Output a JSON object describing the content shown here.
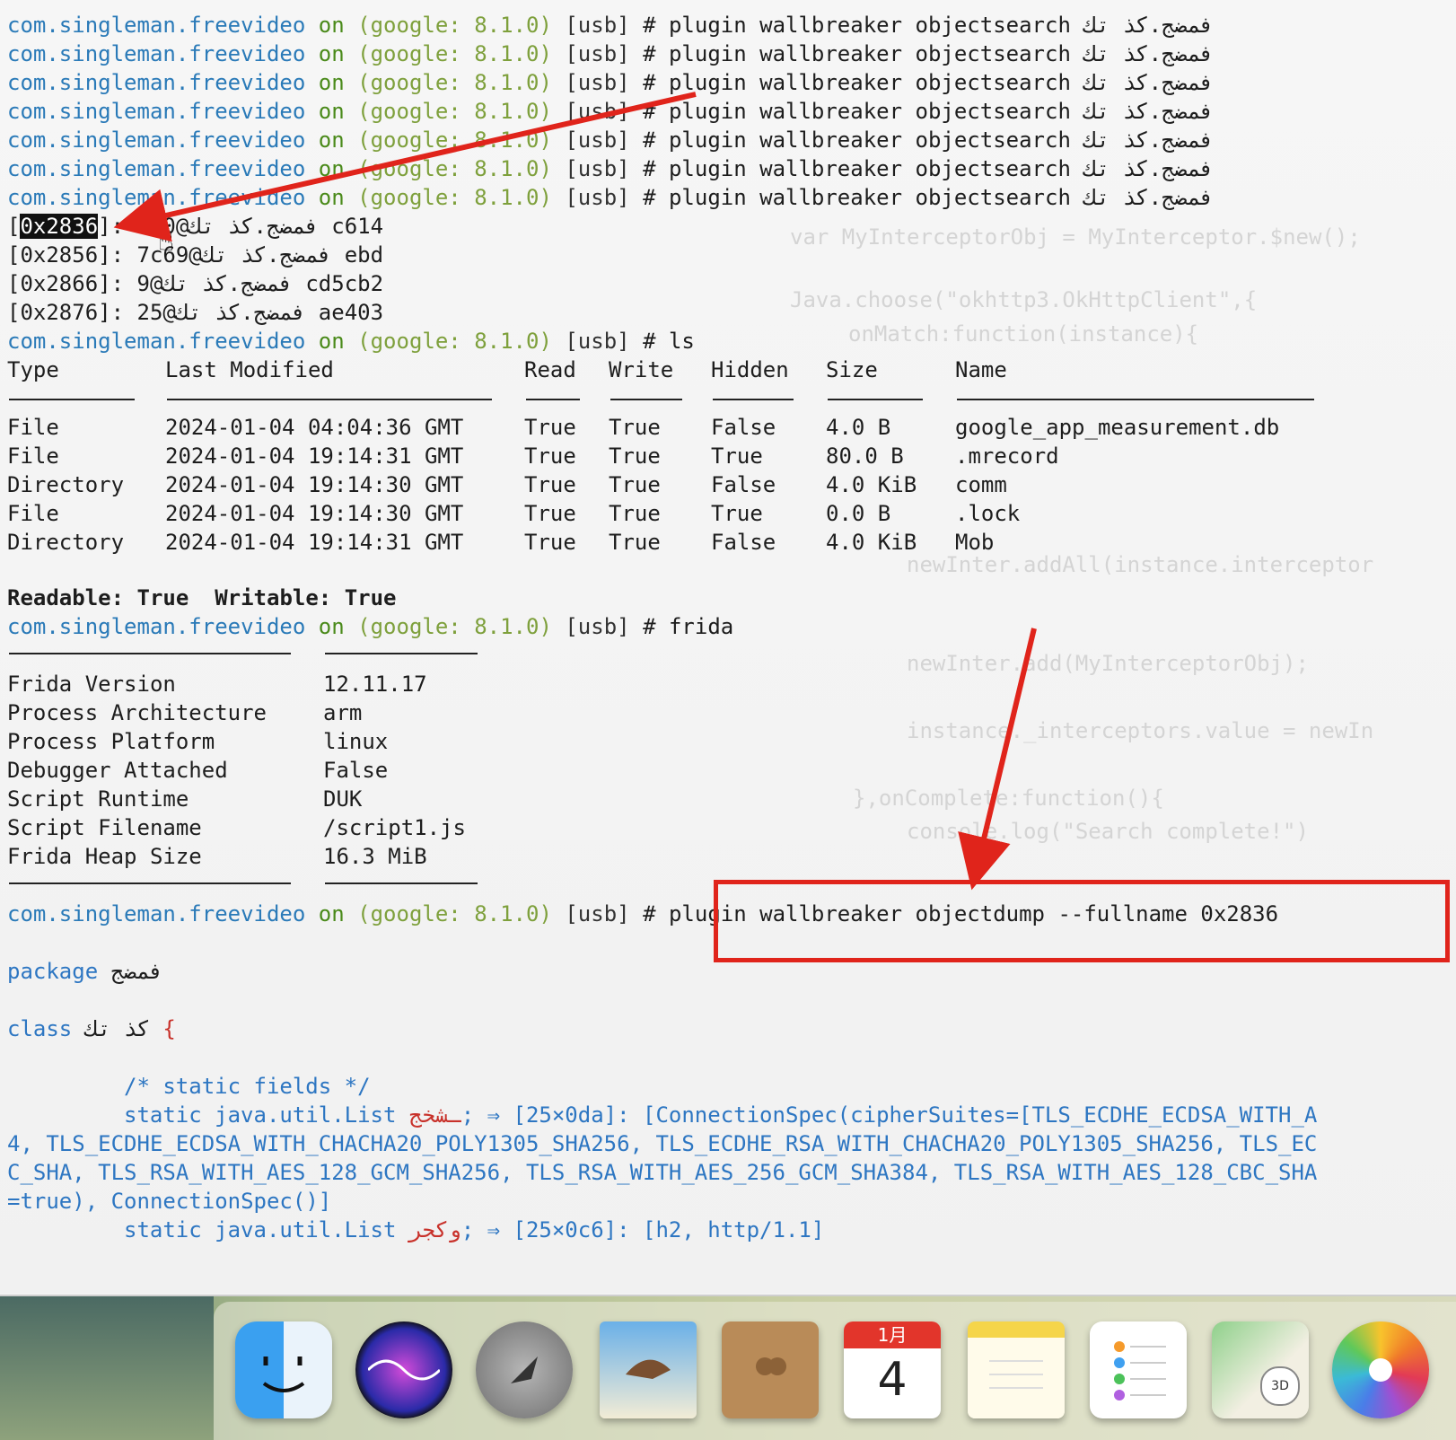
{
  "terminal": {
    "prompt": {
      "app": "com.singleman.freevideo",
      "on": "on",
      "device": "(google: 8.1.0)",
      "conn": "[usb]",
      "hash": "#"
    },
    "search_lines": [
      {
        "cmd": "plugin wallbreaker objectsearch فمضج.كذ تك"
      },
      {
        "cmd": "plugin wallbreaker objectsearch فمضج.كذ تك"
      },
      {
        "cmd": "plugin wallbreaker objectsearch فمضج.كذ تك"
      },
      {
        "cmd": "plugin wallbreaker objectsearch فمضج.كذ تك"
      },
      {
        "cmd": "plugin wallbreaker objectsearch فمضج.كذ تك"
      },
      {
        "cmd": "plugin wallbreaker objectsearch فمضج.كذ تك"
      },
      {
        "cmd": "plugin wallbreaker objectsearch فمضج.كذ تك"
      }
    ],
    "results": [
      {
        "handle": "0x2836",
        "value": ": 550@فمضج.كذ تك c614"
      },
      {
        "handle": "[0x2856]",
        "value": ": 7c69@فمضج.كذ تك ebd"
      },
      {
        "handle": "[0x2866]",
        "value": ": 9@فمضج.كذ تك cd5cb2"
      },
      {
        "handle": "[0x2876]",
        "value": ": 25@فمضج.كذ تك ae403"
      }
    ],
    "ls_cmd": "ls",
    "ls_table": {
      "headers": [
        "Type",
        "Last Modified",
        "Read",
        "Write",
        "Hidden",
        "Size",
        "Name"
      ],
      "rows": [
        [
          "File",
          "2024-01-04 04:04:36 GMT",
          "True",
          "True",
          "False",
          "4.0 B",
          "google_app_measurement.db"
        ],
        [
          "File",
          "2024-01-04 19:14:31 GMT",
          "True",
          "True",
          "True",
          "80.0 B",
          ".mrecord"
        ],
        [
          "Directory",
          "2024-01-04 19:14:30 GMT",
          "True",
          "True",
          "False",
          "4.0 KiB",
          "comm"
        ],
        [
          "File",
          "2024-01-04 19:14:30 GMT",
          "True",
          "True",
          "True",
          "0.0 B",
          ".lock"
        ],
        [
          "Directory",
          "2024-01-04 19:14:31 GMT",
          "True",
          "True",
          "False",
          "4.0 KiB",
          "Mob"
        ]
      ]
    },
    "readable_label": "Readable:",
    "readable_value": "True",
    "writable_label": "Writable:",
    "writable_value": "True",
    "frida_cmd": "frida",
    "frida_info": [
      [
        "Frida Version",
        "12.11.17"
      ],
      [
        "Process Architecture",
        "arm"
      ],
      [
        "Process Platform",
        "linux"
      ],
      [
        "Debugger Attached",
        "False"
      ],
      [
        "Script Runtime",
        "DUK"
      ],
      [
        "Script Filename",
        "/script1.js"
      ],
      [
        "Frida Heap Size",
        "16.3 MiB"
      ]
    ],
    "dump_cmd": "plugin wallbreaker objectdump --fullname 0x2836",
    "package_kw": "package",
    "package_name": "فمضج",
    "class_kw": "class",
    "class_name": "كذ تك",
    "brace": "{",
    "static_comment": "/* static fields */",
    "field1_decl": "static java.util.List",
    "field1_name": "ـشخج",
    "field1_rest": "; ⇒ [0×25da]: [ConnectionSpec(cipherSuites=[TLS_ECDHE_ECDSA_WITH_A",
    "wrap1": "4, TLS_ECDHE_ECDSA_WITH_CHACHA20_POLY1305_SHA256, TLS_ECDHE_RSA_WITH_CHACHA20_POLY1305_SHA256, TLS_EC",
    "wrap2": "C_SHA, TLS_RSA_WITH_AES_128_GCM_SHA256, TLS_RSA_WITH_AES_256_GCM_SHA384, TLS_RSA_WITH_AES_128_CBC_SHA",
    "wrap3": "=true), ConnectionSpec()]",
    "field2_decl": "static java.util.List",
    "field2_name": "وكجر",
    "field2_rest": "; ⇒ [0×25c6]: [h2, http/1.1]"
  },
  "dock": {
    "items": [
      {
        "name": "Finder",
        "icon": "finder-icon"
      },
      {
        "name": "Siri",
        "icon": "siri-icon"
      },
      {
        "name": "Launchpad",
        "icon": "launchpad-icon"
      },
      {
        "name": "Mail",
        "icon": "mail-icon"
      },
      {
        "name": "Contacts",
        "icon": "contacts-icon"
      },
      {
        "name": "Calendar",
        "icon": "calendar-icon",
        "month": "1月",
        "day": "4"
      },
      {
        "name": "Notes",
        "icon": "notes-icon"
      },
      {
        "name": "Reminders",
        "icon": "reminders-icon"
      },
      {
        "name": "Maps",
        "icon": "maps-icon",
        "badge": "3D"
      },
      {
        "name": "Photos",
        "icon": "photos-icon"
      }
    ]
  },
  "colors": {
    "accent_red": "#e0241b",
    "app_blue": "#2a7ab8",
    "device_green": "#7ea03c"
  }
}
